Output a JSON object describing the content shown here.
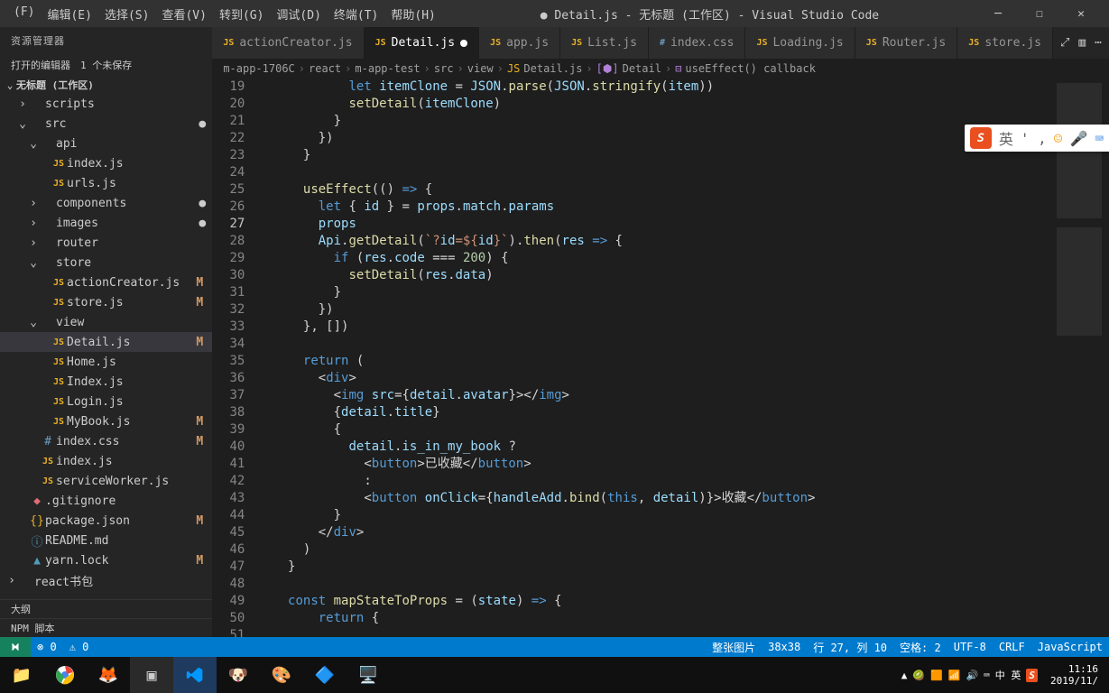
{
  "menu": {
    "items": [
      "(F)",
      "编辑(E)",
      "选择(S)",
      "查看(V)",
      "转到(G)",
      "调试(D)",
      "终端(T)",
      "帮助(H)"
    ],
    "title": "● Detail.js - 无标题 (工作区) - Visual Studio Code"
  },
  "sidebar": {
    "header": "资源管理器",
    "openEditors": "打开的编辑器　1 个未保存",
    "workspace": "无标题 (工作区)",
    "tree": [
      {
        "d": 1,
        "t": "folder",
        "chev": "›",
        "label": "scripts"
      },
      {
        "d": 1,
        "t": "folder",
        "chev": "⌄",
        "label": "src",
        "dot": "●"
      },
      {
        "d": 2,
        "t": "folder",
        "chev": "⌄",
        "label": "api"
      },
      {
        "d": 3,
        "t": "js",
        "label": "index.js"
      },
      {
        "d": 3,
        "t": "js",
        "label": "urls.js"
      },
      {
        "d": 2,
        "t": "folder",
        "chev": "›",
        "label": "components",
        "dot": "●"
      },
      {
        "d": 2,
        "t": "folder",
        "chev": "›",
        "label": "images",
        "dot": "●"
      },
      {
        "d": 2,
        "t": "folder",
        "chev": "›",
        "label": "router"
      },
      {
        "d": 2,
        "t": "folder",
        "chev": "⌄",
        "label": "store"
      },
      {
        "d": 3,
        "t": "js",
        "label": "actionCreator.js",
        "m": "M"
      },
      {
        "d": 3,
        "t": "js",
        "label": "store.js",
        "m": "M"
      },
      {
        "d": 2,
        "t": "folder",
        "chev": "⌄",
        "label": "view"
      },
      {
        "d": 3,
        "t": "js",
        "label": "Detail.js",
        "m": "M",
        "sel": true
      },
      {
        "d": 3,
        "t": "js",
        "label": "Home.js"
      },
      {
        "d": 3,
        "t": "js",
        "label": "Index.js"
      },
      {
        "d": 3,
        "t": "js",
        "label": "Login.js"
      },
      {
        "d": 3,
        "t": "js",
        "label": "MyBook.js",
        "m": "M"
      },
      {
        "d": 2,
        "t": "css",
        "label": "index.css",
        "m": "M"
      },
      {
        "d": 2,
        "t": "js",
        "label": "index.js"
      },
      {
        "d": 2,
        "t": "js",
        "label": "serviceWorker.js"
      },
      {
        "d": 1,
        "t": "git",
        "label": ".gitignore"
      },
      {
        "d": 1,
        "t": "json",
        "label": "package.json",
        "m": "M"
      },
      {
        "d": 1,
        "t": "md",
        "label": "README.md"
      },
      {
        "d": 1,
        "t": "yarn",
        "label": "yarn.lock",
        "m": "M"
      },
      {
        "d": 0,
        "t": "folder",
        "chev": "›",
        "label": "react书包"
      }
    ],
    "outline": "大纲",
    "npm": "NPM 脚本"
  },
  "tabs": [
    {
      "icon": "js",
      "label": "actionCreator.js"
    },
    {
      "icon": "js",
      "label": "Detail.js",
      "active": true,
      "modified": true
    },
    {
      "icon": "js",
      "label": "app.js"
    },
    {
      "icon": "js",
      "label": "List.js"
    },
    {
      "icon": "css",
      "label": "index.css"
    },
    {
      "icon": "js",
      "label": "Loading.js"
    },
    {
      "icon": "js",
      "label": "Router.js"
    },
    {
      "icon": "js",
      "label": "store.js"
    }
  ],
  "breadcrumb": [
    "m-app-1706C",
    "react",
    "m-app-test",
    "src",
    "view",
    "Detail.js",
    "Detail",
    "useEffect() callback"
  ],
  "bcIcons": [
    "",
    "",
    "",
    "",
    "",
    "JS",
    "[⬢]",
    "⊟"
  ],
  "lines": {
    "start": 19,
    "end": 51
  },
  "code": [
    "            let itemClone = JSON.parse(JSON.stringify(item))",
    "            setDetail(itemClone)",
    "          }",
    "        })",
    "      }",
    "",
    "      useEffect(() => {",
    "        let { id } = props.match.params",
    "        props",
    "        Api.getDetail(`?id=${id}`).then(res => {",
    "          if (res.code === 200) {",
    "            setDetail(res.data)",
    "          }",
    "        })",
    "      }, [])",
    "",
    "      return (",
    "        <div>",
    "          <img src={detail.avatar}></img>",
    "          {detail.title}",
    "          {",
    "            detail.is_in_my_book ?",
    "              <button>已收藏</button>",
    "              :",
    "              <button onClick={handleAdd.bind(this, detail)}>收藏</button>",
    "          }",
    "        </div>",
    "      )",
    "    }",
    "",
    "    const mapStateToProps = (state) => {",
    "        return {"
  ],
  "statusbar": {
    "errors": "⊗ 0",
    "warnings": "⚠ 0",
    "right": [
      "整张图片",
      "38x38",
      "行 27, 列 10",
      "空格: 2",
      "UTF-8",
      "CRLF",
      "JavaScript"
    ]
  },
  "taskbar": {
    "clock": {
      "time": "11:16",
      "date": "2019/11/"
    }
  },
  "ime": {
    "label": "英"
  }
}
